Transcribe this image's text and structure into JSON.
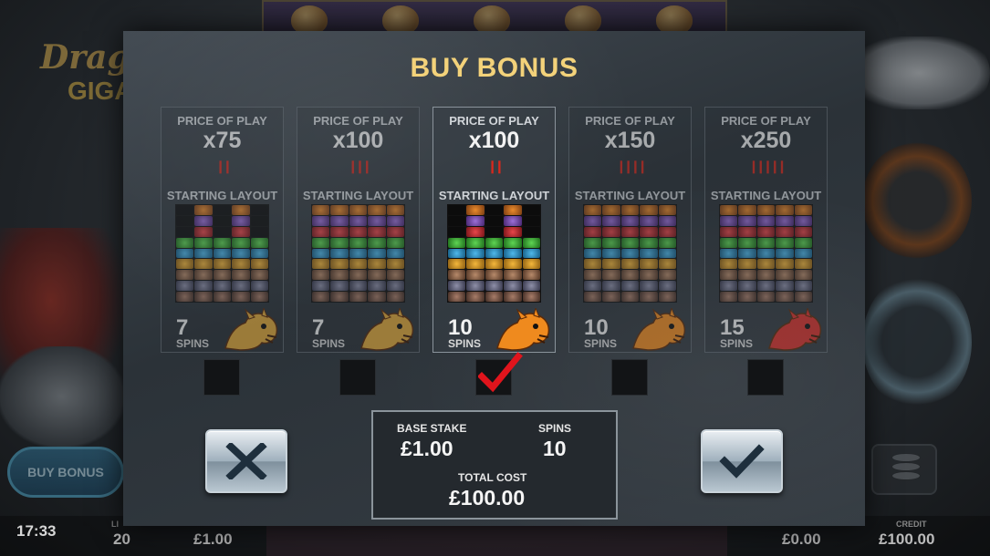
{
  "game": {
    "logo_line1": "Drag",
    "logo_line2": "GIGA"
  },
  "background": {
    "buy_bonus_button": "BUY BONUS",
    "clock": "17:33",
    "lines_label": "LI",
    "lines_value": "20",
    "bet_value": "£1.00",
    "win_value": "£0.00",
    "credit_label": "CREDIT",
    "credit_value": "£100.00"
  },
  "modal": {
    "title": "BUY BONUS",
    "options": [
      {
        "price_label": "PRICE OF PLAY",
        "multiplier": "x75",
        "chilis": 2,
        "layout_label": "STARTING LAYOUT",
        "spins": "7",
        "spins_label": "SPINS",
        "dragon_color": "#e0a83a",
        "selected": false,
        "layout": "A"
      },
      {
        "price_label": "PRICE OF PLAY",
        "multiplier": "x100",
        "chilis": 3,
        "layout_label": "STARTING LAYOUT",
        "spins": "7",
        "spins_label": "SPINS",
        "dragon_color": "#e0a83a",
        "selected": false,
        "layout": "B"
      },
      {
        "price_label": "PRICE OF PLAY",
        "multiplier": "x100",
        "chilis": 2,
        "layout_label": "STARTING LAYOUT",
        "spins": "10",
        "spins_label": "SPINS",
        "dragon_color": "#ef8a1e",
        "selected": true,
        "layout": "A"
      },
      {
        "price_label": "PRICE OF PLAY",
        "multiplier": "x150",
        "chilis": 4,
        "layout_label": "STARTING LAYOUT",
        "spins": "10",
        "spins_label": "SPINS",
        "dragon_color": "#ef8a1e",
        "selected": false,
        "layout": "B"
      },
      {
        "price_label": "PRICE OF PLAY",
        "multiplier": "x250",
        "chilis": 5,
        "layout_label": "STARTING LAYOUT",
        "spins": "15",
        "spins_label": "SPINS",
        "dragon_color": "#d8302a",
        "selected": false,
        "layout": "B"
      }
    ],
    "summary": {
      "base_stake_label": "BASE STAKE",
      "base_stake_value": "£1.00",
      "spins_label": "SPINS",
      "spins_value": "10",
      "total_cost_label": "TOTAL COST",
      "total_cost_value": "£100.00"
    },
    "cancel_icon": "close-icon",
    "confirm_icon": "checkmark-icon",
    "accent_color": "#f3d27a",
    "check_color": "#e0141c"
  }
}
